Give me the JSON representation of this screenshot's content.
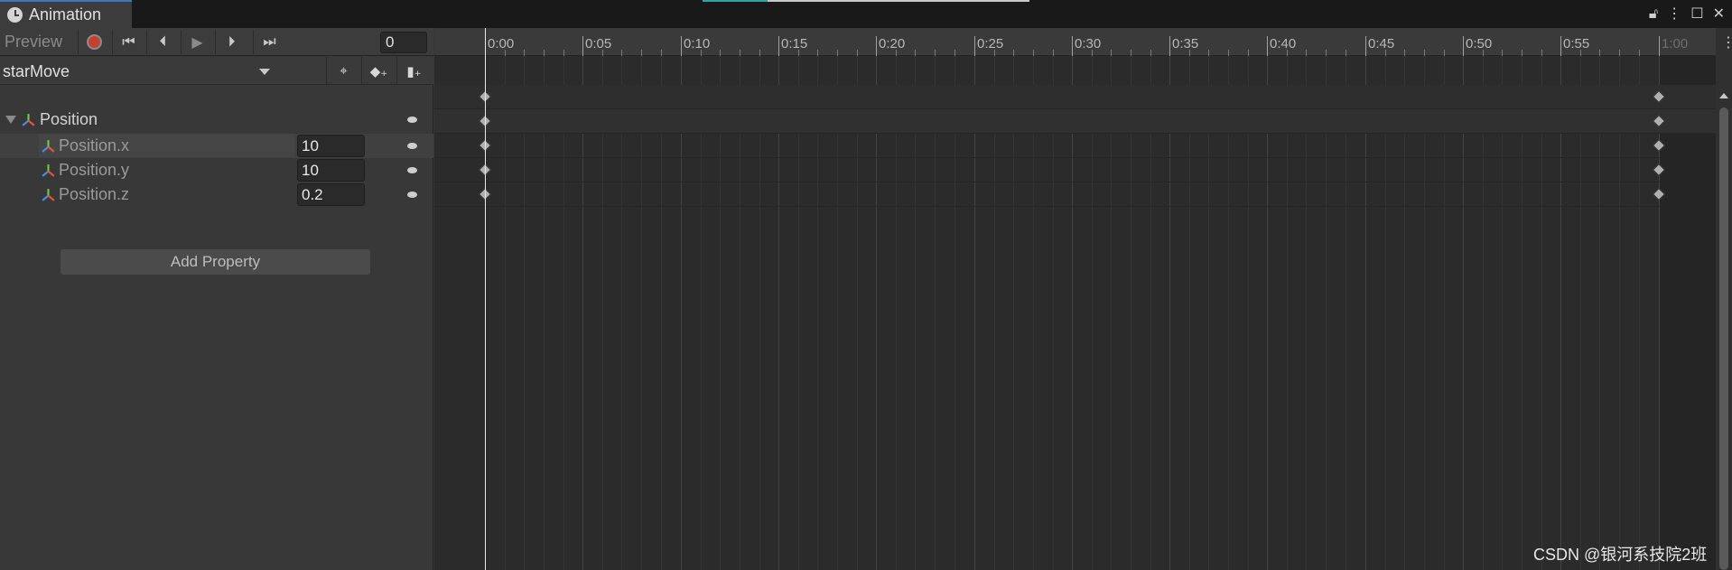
{
  "window": {
    "tab_title": "Animation",
    "controls": [
      "lock-icon",
      "more-icon",
      "maximize-icon",
      "close-icon"
    ]
  },
  "toolbar": {
    "preview_label": "Preview",
    "frame_value": "0",
    "buttons": [
      "record-button",
      "first-key-button",
      "prev-key-button",
      "play-button",
      "next-key-button",
      "last-key-button"
    ]
  },
  "clip": {
    "name": "starMove"
  },
  "properties": [
    {
      "label": "Position",
      "value": "",
      "level": 0
    },
    {
      "label": "Position.x",
      "value": "10",
      "level": 1
    },
    {
      "label": "Position.y",
      "value": "10",
      "level": 1
    },
    {
      "label": "Position.z",
      "value": "0.2",
      "level": 1
    }
  ],
  "add_property_label": "Add Property",
  "timeline": {
    "labels": [
      "0:00",
      "0:05",
      "0:10",
      "0:15",
      "0:20",
      "0:25",
      "0:30",
      "0:35",
      "0:40",
      "0:45",
      "0:50",
      "0:55",
      "1:00"
    ],
    "keyframes": [
      "0:00",
      "1:00"
    ]
  },
  "watermark": "CSDN @银河系技院2班",
  "colors": {
    "accent": "#3a79bb",
    "record": "#c4412f",
    "teal": "#2aa6a0"
  }
}
